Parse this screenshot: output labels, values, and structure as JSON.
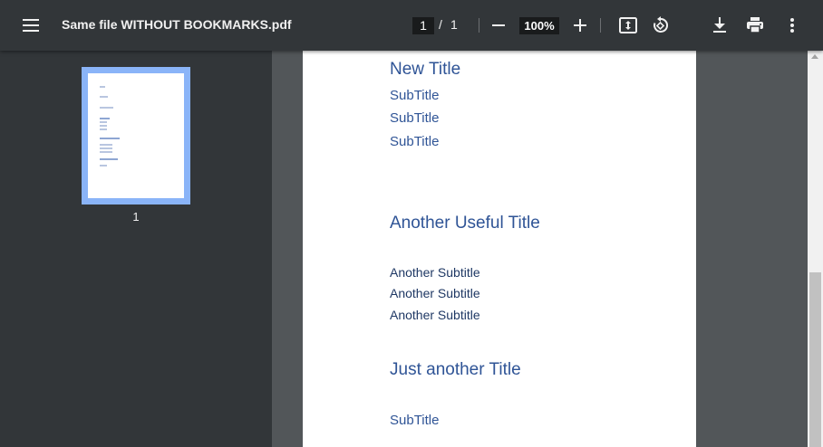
{
  "toolbar": {
    "title": "Same file WITHOUT BOOKMARKS.pdf",
    "page_current": "1",
    "page_sep": "/",
    "page_total": "1",
    "zoom": "100%",
    "icons": [
      "menu-icon",
      "zoom-out-icon",
      "zoom-in-icon",
      "fit-page-icon",
      "rotate-icon",
      "download-icon",
      "print-icon",
      "more-vert-icon"
    ]
  },
  "sidebar": {
    "thumbnail_label": "1"
  },
  "document": {
    "items": [
      {
        "text": "New Title",
        "kind": "h1"
      },
      {
        "text": "SubTitle",
        "kind": "h2"
      },
      {
        "text": "SubTitle",
        "kind": "h2"
      },
      {
        "text": "SubTitle",
        "kind": "h2"
      },
      {
        "text": "Another Useful Title",
        "kind": "h1"
      },
      {
        "text": "Another Subtitle",
        "kind": "h3"
      },
      {
        "text": "Another Subtitle",
        "kind": "h3"
      },
      {
        "text": "Another Subtitle",
        "kind": "h3"
      },
      {
        "text": "Just another Title",
        "kind": "h1"
      },
      {
        "text": "SubTitle",
        "kind": "h2"
      }
    ]
  },
  "colors": {
    "toolbar_bg": "#323639",
    "viewer_bg": "#525659",
    "heading_blue": "#2f5496",
    "thumb_highlight": "#8ab4f8"
  }
}
